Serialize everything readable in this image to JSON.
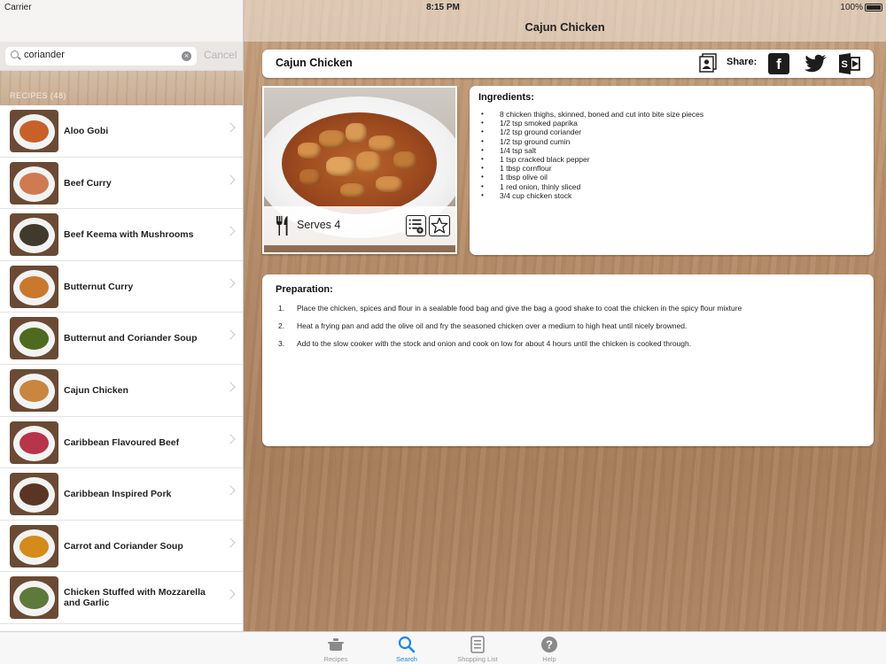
{
  "status_bar": {
    "carrier": "Carrier",
    "time": "8:15 PM",
    "battery": "100%"
  },
  "search": {
    "query": "coriander",
    "cancel_label": "Cancel"
  },
  "section_header": "RECIPES (48)",
  "recipes": [
    {
      "name": "Aloo Gobi",
      "food_color": "#c8602a"
    },
    {
      "name": "Beef Curry",
      "food_color": "#d07a52"
    },
    {
      "name": "Beef Keema with Mushrooms",
      "food_color": "#3f3a2c"
    },
    {
      "name": "Butternut Curry",
      "food_color": "#c9782e"
    },
    {
      "name": "Butternut and Coriander Soup",
      "food_color": "#4e6a1e"
    },
    {
      "name": "Cajun Chicken",
      "food_color": "#c9863e"
    },
    {
      "name": "Caribbean Flavoured Beef",
      "food_color": "#b8344a"
    },
    {
      "name": "Caribbean Inspired Pork",
      "food_color": "#5b3524"
    },
    {
      "name": "Carrot and Coriander Soup",
      "food_color": "#d58a1c"
    },
    {
      "name": "Chicken Stuffed with Mozzarella and Garlic",
      "food_color": "#5e7a3a"
    }
  ],
  "detail": {
    "nav_title": "Cajun Chicken",
    "recipe_title": "Cajun Chicken",
    "share_label": "Share:",
    "serves": "Serves 4",
    "ingredients_heading": "Ingredients:",
    "ingredients": [
      "8 chicken thighs, skinned, boned and cut into bite size pieces",
      "1/2 tsp smoked paprika",
      "1/2 tsp ground coriander",
      "1/2 tsp ground cumin",
      "1/4 tsp salt",
      "1 tsp cracked black pepper",
      "1 tbsp cornflour",
      "1 tbsp olive oil",
      "1 red onion, thinly sliced",
      "3/4 cup chicken stock"
    ],
    "preparation_heading": "Preparation:",
    "steps": [
      {
        "num": "1.",
        "text": "Place the chicken, spices and flour in a sealable food bag and give the bag a good shake to coat the chicken in the spicy flour mixture"
      },
      {
        "num": "2.",
        "text": "Heat a frying pan and add the olive oil and fry the seasoned chicken over a medium to high heat until nicely browned."
      },
      {
        "num": "3.",
        "text": "Add to the slow cooker with the stock and onion and cook on low for about 4 hours until the chicken is cooked through."
      }
    ]
  },
  "tabs": [
    {
      "label": "Recipes",
      "icon": "pot-icon",
      "active": false
    },
    {
      "label": "Search",
      "icon": "search-icon",
      "active": true
    },
    {
      "label": "Shopping List",
      "icon": "list-icon",
      "active": false
    },
    {
      "label": "Help",
      "icon": "help-icon",
      "active": false
    }
  ],
  "colors": {
    "accent": "#1e88e5",
    "wood": "#b58d6b"
  }
}
